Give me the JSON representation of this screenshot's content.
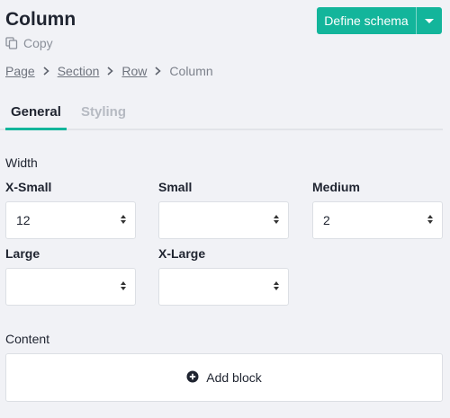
{
  "header": {
    "title": "Column",
    "copy_label": "Copy",
    "schema_button_label": "Define schema"
  },
  "breadcrumb": {
    "items": [
      "Page",
      "Section",
      "Row"
    ],
    "current": "Column"
  },
  "tabs": [
    {
      "label": "General",
      "active": true
    },
    {
      "label": "Styling",
      "active": false
    }
  ],
  "width": {
    "heading": "Width",
    "fields": [
      {
        "label": "X-Small",
        "value": "12"
      },
      {
        "label": "Small",
        "value": ""
      },
      {
        "label": "Medium",
        "value": "2"
      },
      {
        "label": "Large",
        "value": ""
      },
      {
        "label": "X-Large",
        "value": ""
      }
    ]
  },
  "content": {
    "heading": "Content",
    "add_block_label": "Add block"
  },
  "colors": {
    "accent": "#13b59b",
    "background": "#f1f2f6",
    "text": "#1f2430",
    "muted": "#8b909a"
  }
}
